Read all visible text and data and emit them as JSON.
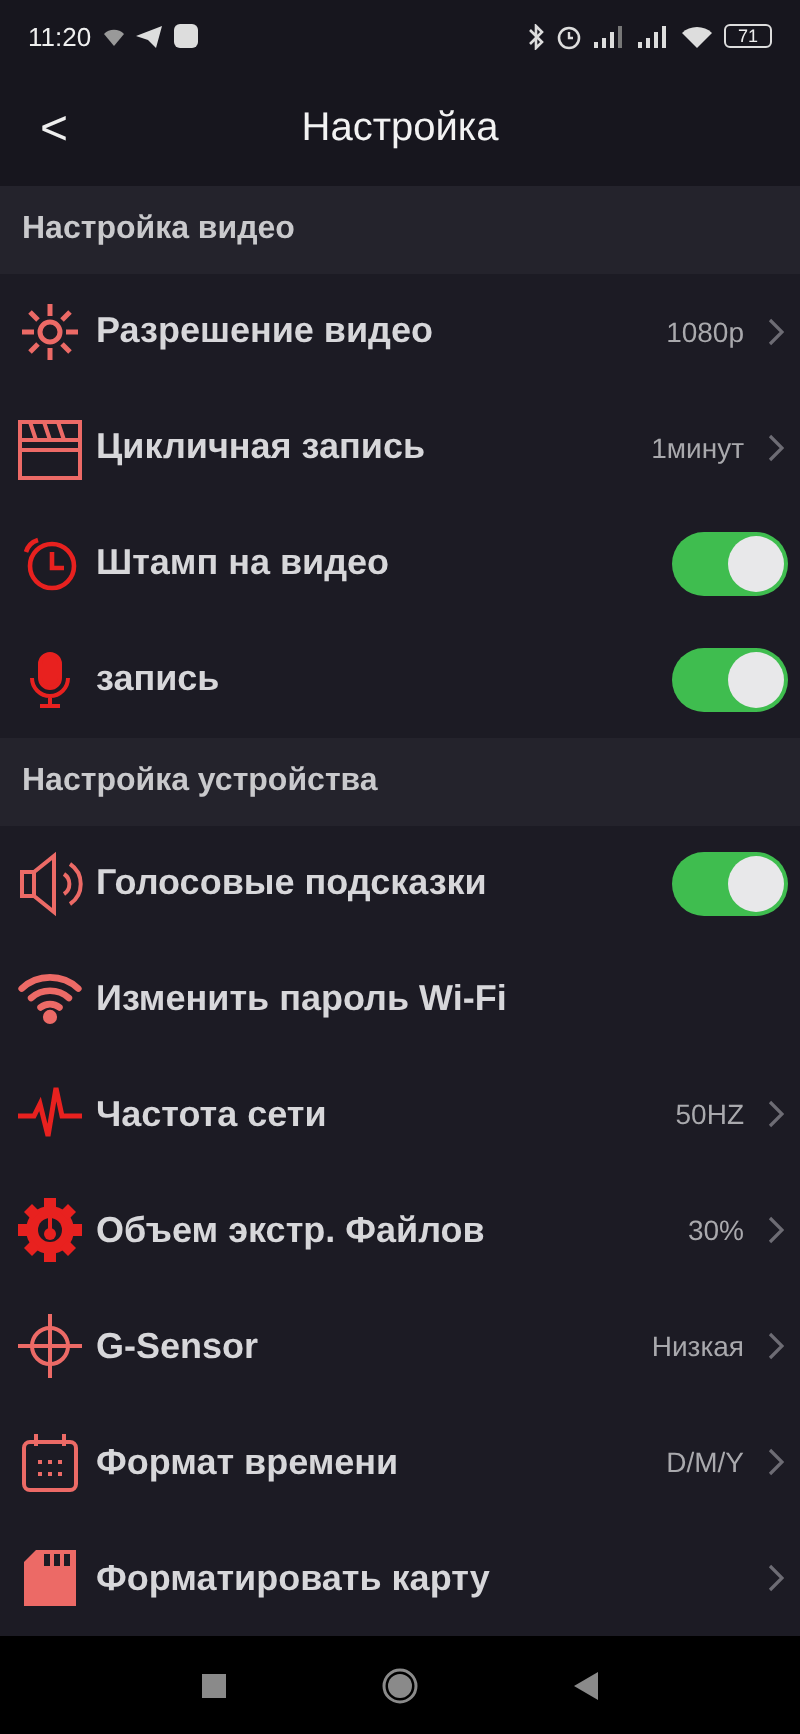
{
  "status_bar": {
    "time": "11:20",
    "battery": "71"
  },
  "header": {
    "back": "<",
    "title": "Настройка"
  },
  "sections": [
    {
      "title": "Настройка видео",
      "rows": [
        {
          "kind": "value",
          "label": "Разрешение видео",
          "value": "1080p"
        },
        {
          "kind": "value",
          "label": "Цикличная запись",
          "value": "1минут"
        },
        {
          "kind": "toggle",
          "label": "Штамп на видео",
          "on": true
        },
        {
          "kind": "toggle",
          "label": "запись",
          "on": true
        }
      ]
    },
    {
      "title": "Настройка устройства",
      "rows": [
        {
          "kind": "toggle",
          "label": "Голосовые подсказки",
          "on": true
        },
        {
          "kind": "plain",
          "label": "Изменить пароль Wi-Fi"
        },
        {
          "kind": "value",
          "label": "Частота сети",
          "value": "50HZ"
        },
        {
          "kind": "value",
          "label": "Объем экстр. Файлов",
          "value": "30%"
        },
        {
          "kind": "value",
          "label": "G-Sensor",
          "value": "Низкая"
        },
        {
          "kind": "value",
          "label": "Формат времени",
          "value": "D/M/Y"
        },
        {
          "kind": "chevron",
          "label": "Форматировать карту"
        }
      ]
    }
  ]
}
